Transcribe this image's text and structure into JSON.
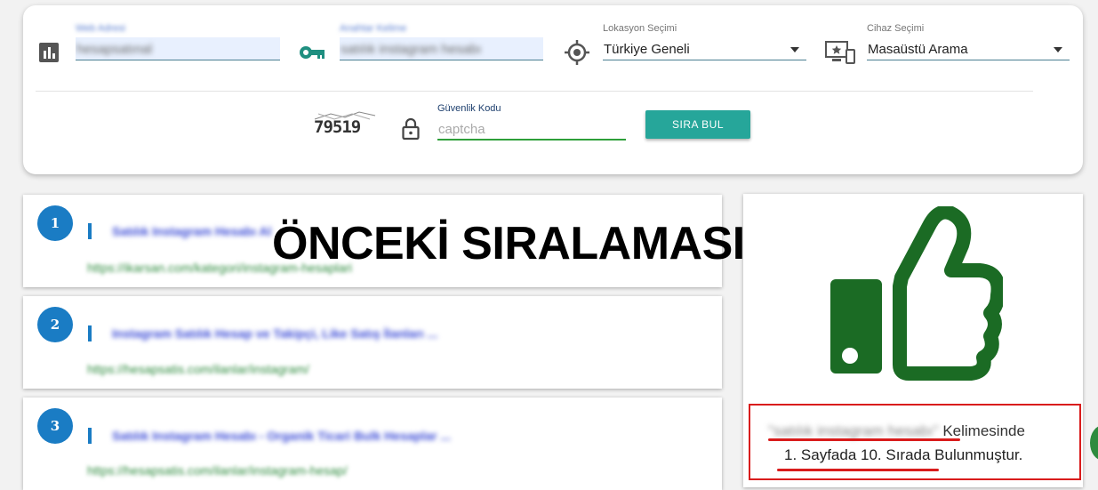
{
  "form": {
    "website": {
      "label": "Web Adresi",
      "value": "hesapsatınal"
    },
    "keyword": {
      "label": "Anahtar Kelime",
      "value": "satılık instagram hesabı"
    },
    "location": {
      "label": "Lokasyon Seçimi",
      "value": "Türkiye Geneli"
    },
    "device": {
      "label": "Cihaz Seçimi",
      "value": "Masaüstü Arama"
    },
    "captcha": {
      "image_text": "79519",
      "label": "Güvenlik Kodu",
      "placeholder": "captcha"
    },
    "submit_label": "SIRA BUL"
  },
  "icons": {
    "website": "bar-chart-icon",
    "keyword": "key-icon",
    "location": "gps-target-icon",
    "device": "devices-icon",
    "captcha": "lock-icon"
  },
  "overlay_heading": "ÖNCEKİ SIRALAMASI",
  "results": [
    {
      "rank": "1",
      "title": "Satılık Instagram Hesabı Al",
      "url": "https://ikarsan.com/kategori/instagram-hesaplari"
    },
    {
      "rank": "2",
      "title": "Instagram Satılık Hesap ve Takipçi, Like Satış İlanları ...",
      "url": "https://hesapsatis.com/ilanlar/instagram/"
    },
    {
      "rank": "3",
      "title": "Satılık Instagram Hesabı - Organik Ticari Bulk Hesaplar ...",
      "url": "https://hesapsatis.com/ilanlar/instagram-hesap/"
    }
  ],
  "summary": {
    "keyword": "\"satılık instagram hesabı\"",
    "keyword_suffix": " Kelimesinde",
    "position_text": "1. Sayfada 10. Sırada Bulunmuştur."
  },
  "colors": {
    "accent_teal": "#26a69a",
    "rank_blue": "#1a7cc4",
    "thumb_green": "#1b6b24",
    "highlight_red": "#d91c1c"
  }
}
